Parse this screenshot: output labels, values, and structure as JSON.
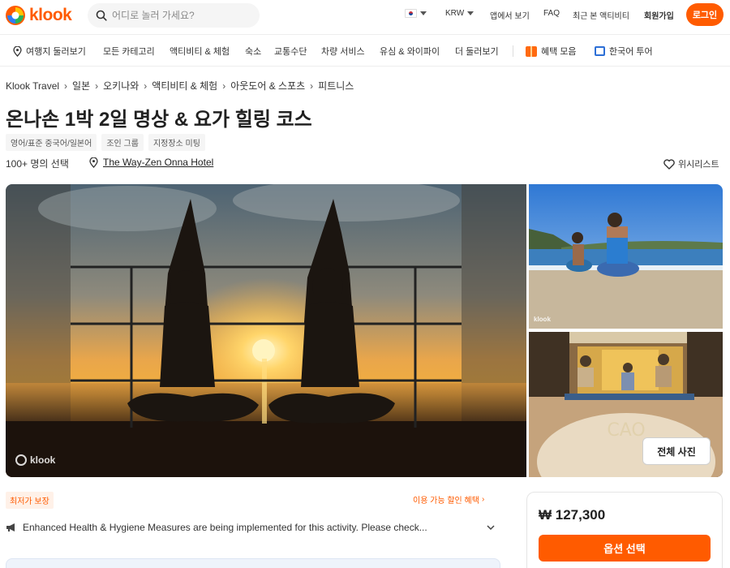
{
  "header": {
    "logo_text": "klook",
    "search_placeholder": "어디로 놀러 가세요?",
    "currency": "KRW",
    "app_link": "앱에서 보기",
    "faq": "FAQ",
    "recent": "최근 본 액티비티",
    "signup": "회원가입",
    "login": "로그인",
    "brand_color": "#ff5b00"
  },
  "nav": {
    "items": [
      "여행지 둘러보기",
      "모든 카테고리",
      "액티비티 & 체험",
      "숙소",
      "교통수단",
      "차량 서비스",
      "유심 & 와이파이",
      "더 둘러보기"
    ],
    "deals": "혜택 모음",
    "korean_tour": "한국어 투어"
  },
  "breadcrumb": [
    "Klook Travel",
    "일본",
    "오키나와",
    "액티비티 & 체험",
    "아웃도어 & 스포츠",
    "피트니스"
  ],
  "activity": {
    "title": "온나손 1박 2일 명상 & 요가 힐링 코스",
    "tags": [
      "영어/표준 중국어/일본어",
      "조인 그룹",
      "지정장소 미팅"
    ],
    "booked": "100+ 명의 선택",
    "location": "The Way-Zen Onna Hotel",
    "wishlist": "위시리스트"
  },
  "gallery": {
    "watermark": "klook",
    "all_photos": "전체 사진"
  },
  "info": {
    "best_price": "최저가 보장",
    "discount": "이용 가능 할인 혜택",
    "notice": "Enhanced Health & Hygiene Measures are being implemented for this activity. Please check..."
  },
  "booking": {
    "price": "₩ 127,300",
    "select": "옵션 선택"
  }
}
